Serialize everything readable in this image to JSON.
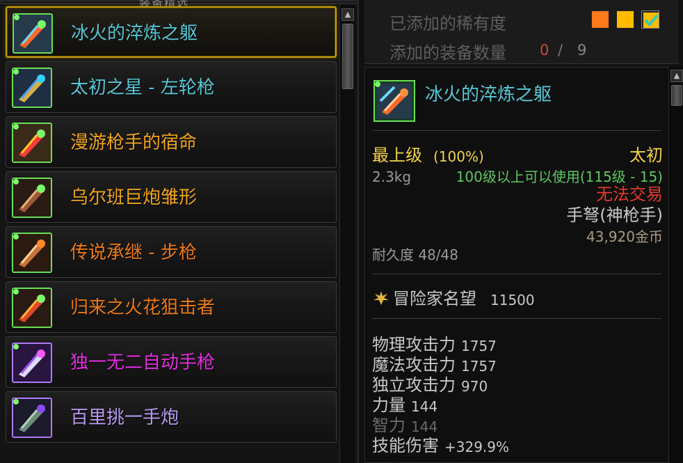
{
  "left_panel": {
    "header_title": "装备精选",
    "items": [
      {
        "name": "冰火的淬炼之躯",
        "color": "#58c7d6",
        "icon": "sword-fire-ice-icon",
        "selected": true
      },
      {
        "name": "太初之星 - 左轮枪",
        "color": "#58c7d6",
        "icon": "revolver-icon"
      },
      {
        "name": "漫游枪手的宿命",
        "color": "#f2a51f",
        "icon": "pistol-red-icon"
      },
      {
        "name": "乌尔班巨炮雏形",
        "color": "#f2a51f",
        "icon": "cannon-icon"
      },
      {
        "name": "传说承继 - 步枪",
        "color": "#ec7a19",
        "icon": "rifle-icon"
      },
      {
        "name": "归来之火花狙击者",
        "color": "#ec7a19",
        "icon": "sniper-icon"
      },
      {
        "name": "独一无二自动手枪",
        "color": "#e22fe0",
        "icon": "auto-pistol-icon"
      },
      {
        "name": "百里挑一手炮",
        "color": "#b89bf0",
        "icon": "hand-cannon-icon"
      }
    ]
  },
  "filter": {
    "rarity_label": "已添加的稀有度",
    "count_label": "添加的装备数量",
    "count_value": "0",
    "count_sep": "/",
    "count_max": "9",
    "swatch_colors": [
      "#ff7a1a",
      "#ffbb00",
      "#3fd0c0"
    ]
  },
  "tooltip": {
    "name": "冰火的淬炼之躯",
    "grade": "最上级",
    "grade_pct": "(100%)",
    "tier": "太初",
    "weight": "2.3kg",
    "level_req": "100级以上可以使用(115级 - 15)",
    "trade": "无法交易",
    "type": "手弩(神枪手)",
    "price": "43,920金币",
    "durability": "耐久度 48/48",
    "fame_label": "冒险家名望",
    "fame_value": "11500",
    "stats": [
      {
        "name": "物理攻击力",
        "value": "1757"
      },
      {
        "name": "魔法攻击力",
        "value": "1757"
      },
      {
        "name": "独立攻击力",
        "value": "970"
      },
      {
        "name": "力量",
        "value": "144"
      },
      {
        "name": "智力",
        "value": "144"
      },
      {
        "name": "技能伤害",
        "value": "+329.9%"
      }
    ]
  },
  "colors": {
    "rare_cyan": "#58c7d6",
    "legend_orange": "#f2a51f",
    "epic_orange": "#ec7a19",
    "unique_pink": "#e22fe0",
    "grade_yellow": "#f2d34a",
    "green": "#5ec85e",
    "red": "#e23b2e"
  }
}
